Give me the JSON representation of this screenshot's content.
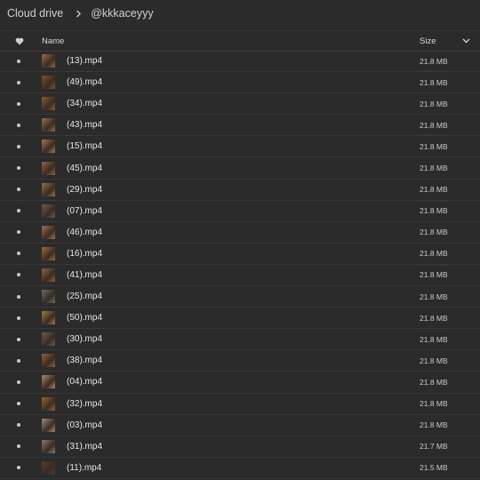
{
  "breadcrumb": {
    "root": "Cloud drive",
    "current": "@kkkaceyyy"
  },
  "table": {
    "col_name": "Name",
    "col_size": "Size",
    "rows": [
      {
        "name": "(13).mp4",
        "size": "21.8 MB",
        "thumb": "#9a6a4a"
      },
      {
        "name": "(49).mp4",
        "size": "21.8 MB",
        "thumb": "#7a5234"
      },
      {
        "name": "(34).mp4",
        "size": "21.8 MB",
        "thumb": "#8c5a36"
      },
      {
        "name": "(43).mp4",
        "size": "21.8 MB",
        "thumb": "#9b6c48"
      },
      {
        "name": "(15).mp4",
        "size": "21.8 MB",
        "thumb": "#a07658"
      },
      {
        "name": "(45).mp4",
        "size": "21.8 MB",
        "thumb": "#8e6646"
      },
      {
        "name": "(29).mp4",
        "size": "21.8 MB",
        "thumb": "#9a7048"
      },
      {
        "name": "(07).mp4",
        "size": "21.8 MB",
        "thumb": "#6e5a4a"
      },
      {
        "name": "(46).mp4",
        "size": "21.8 MB",
        "thumb": "#9a7454"
      },
      {
        "name": "(16).mp4",
        "size": "21.8 MB",
        "thumb": "#a06a40"
      },
      {
        "name": "(41).mp4",
        "size": "21.8 MB",
        "thumb": "#8f6040"
      },
      {
        "name": "(25).mp4",
        "size": "21.8 MB",
        "thumb": "#6f6a62"
      },
      {
        "name": "(50).mp4",
        "size": "21.8 MB",
        "thumb": "#a27a4c"
      },
      {
        "name": "(30).mp4",
        "size": "21.8 MB",
        "thumb": "#6a5a4c"
      },
      {
        "name": "(38).mp4",
        "size": "21.8 MB",
        "thumb": "#8a6442"
      },
      {
        "name": "(04).mp4",
        "size": "21.8 MB",
        "thumb": "#b08a68"
      },
      {
        "name": "(32).mp4",
        "size": "21.8 MB",
        "thumb": "#9a6430"
      },
      {
        "name": "(03).mp4",
        "size": "21.8 MB",
        "thumb": "#a88a72"
      },
      {
        "name": "(31).mp4",
        "size": "21.7 MB",
        "thumb": "#8a7a6a"
      },
      {
        "name": "(11).mp4",
        "size": "21.5 MB",
        "thumb": "#4e3e30"
      }
    ]
  },
  "icons": {
    "favorite": "heart-icon",
    "separator": "chevron-right-icon",
    "sort": "chevron-down-icon",
    "row_marker": "dot-icon"
  }
}
